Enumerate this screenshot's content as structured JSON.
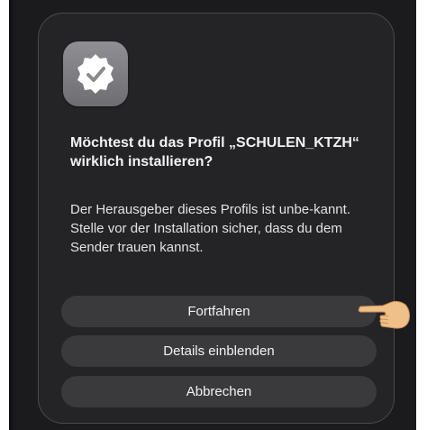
{
  "dialog": {
    "icon": "verified-profile-icon",
    "title": "Möchtest du das Profil „SCHULEN_KTZH“ wirklich installieren?",
    "message": "Der Herausgeber dieses Profils ist unbe-kannt. Stelle vor der Installation sicher, dass du dem Sender trauen kannst.",
    "buttons": {
      "continue_label": "Fortfahren",
      "details_label": "Details einblenden",
      "cancel_label": "Abbrechen"
    }
  },
  "annotation": {
    "icon": "pointing-hand-icon"
  },
  "colors": {
    "background": "#1b1b1d",
    "dialog_background": "#242426",
    "button_background": "#3a3a3c",
    "text": "#f2f2f5",
    "icon_gray": "#7d7d82",
    "hand_skin": "#f0c08a"
  }
}
